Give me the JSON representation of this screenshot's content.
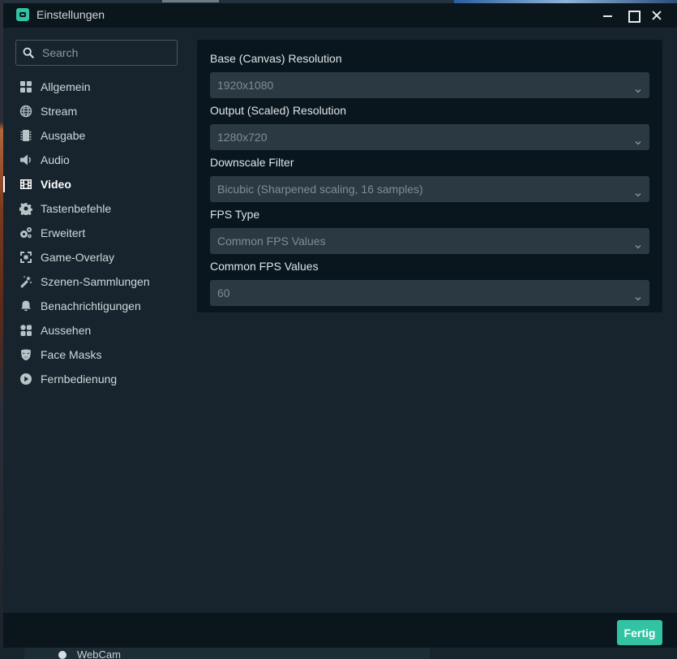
{
  "window": {
    "title": "Einstellungen",
    "icon": "streamlabs-icon"
  },
  "background": {
    "source_item": "WebCam"
  },
  "search": {
    "placeholder": "Search",
    "value": ""
  },
  "sidebar": {
    "items": [
      {
        "label": "Allgemein",
        "icon": "grid-icon",
        "active": false
      },
      {
        "label": "Stream",
        "icon": "globe-icon",
        "active": false
      },
      {
        "label": "Ausgabe",
        "icon": "chip-icon",
        "active": false
      },
      {
        "label": "Audio",
        "icon": "speaker-icon",
        "active": false
      },
      {
        "label": "Video",
        "icon": "film-icon",
        "active": true
      },
      {
        "label": "Tastenbefehle",
        "icon": "gear-icon",
        "active": false
      },
      {
        "label": "Erweitert",
        "icon": "gears-icon",
        "active": false
      },
      {
        "label": "Game-Overlay",
        "icon": "expand-icon",
        "active": false
      },
      {
        "label": "Szenen-Sammlungen",
        "icon": "magic-wand-icon",
        "active": false
      },
      {
        "label": "Benachrichtigungen",
        "icon": "bell-icon",
        "active": false
      },
      {
        "label": "Aussehen",
        "icon": "widgets-icon",
        "active": false
      },
      {
        "label": "Face Masks",
        "icon": "mask-icon",
        "active": false
      },
      {
        "label": "Fernbedienung",
        "icon": "play-circle-icon",
        "active": false
      }
    ]
  },
  "video": {
    "fields": [
      {
        "label": "Base (Canvas) Resolution",
        "value": "1920x1080"
      },
      {
        "label": "Output (Scaled) Resolution",
        "value": "1280x720"
      },
      {
        "label": "Downscale Filter",
        "value": "Bicubic (Sharpened scaling, 16 samples)"
      },
      {
        "label": "FPS Type",
        "value": "Common FPS Values"
      },
      {
        "label": "Common FPS Values",
        "value": "60"
      }
    ]
  },
  "footer": {
    "done_label": "Fertig"
  },
  "colors": {
    "accent": "#31c3a2",
    "dialog_bg": "#17242d",
    "panel_bg": "#09161d",
    "select_bg": "#2b3a42"
  }
}
